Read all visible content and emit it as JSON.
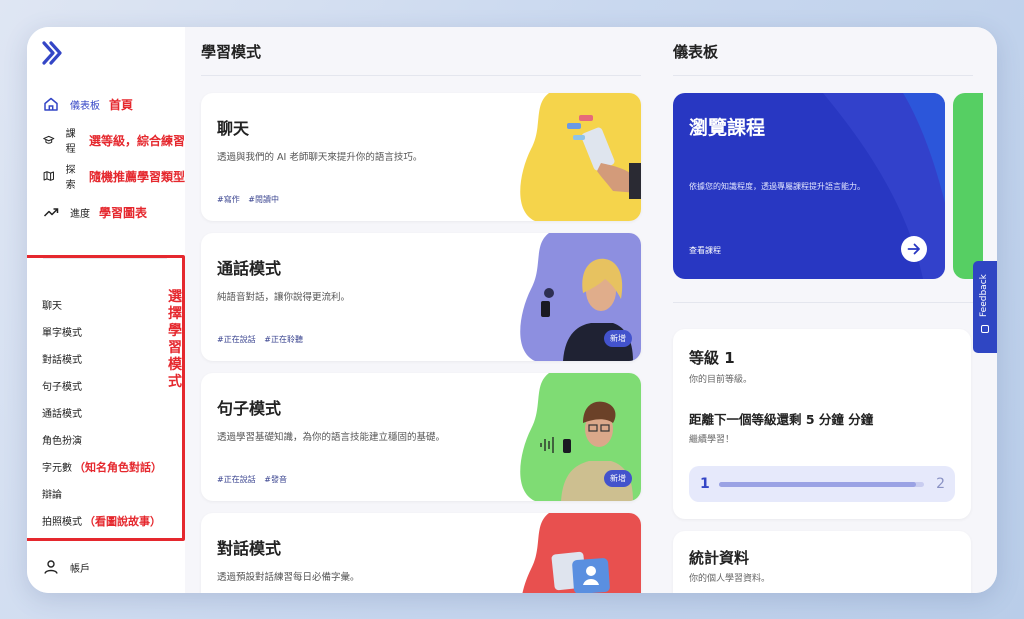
{
  "sidebar": {
    "nav": [
      {
        "label": "儀表板",
        "annotation": "首頁",
        "icon": "home-icon",
        "active": true
      },
      {
        "label": "課程",
        "annotation": "選等級，綜合練習",
        "icon": "graduation-cap-icon"
      },
      {
        "label": "探索",
        "annotation": "隨機推薦學習類型",
        "icon": "map-icon"
      },
      {
        "label": "進度",
        "annotation": "學習圖表",
        "icon": "trending-up-icon"
      }
    ],
    "modes_annotation": "選擇學習模式",
    "modes": [
      {
        "label": "聊天",
        "annotation": ""
      },
      {
        "label": "單字模式",
        "annotation": ""
      },
      {
        "label": "對話模式",
        "annotation": ""
      },
      {
        "label": "句子模式",
        "annotation": ""
      },
      {
        "label": "通話模式",
        "annotation": ""
      },
      {
        "label": "角色扮演",
        "annotation": ""
      },
      {
        "label": "字元數",
        "annotation": "（知名角色對話）"
      },
      {
        "label": "辯論",
        "annotation": ""
      },
      {
        "label": "拍照模式",
        "annotation": "（看圖說故事）"
      }
    ],
    "account_label": "帳戶"
  },
  "main": {
    "title": "學習模式",
    "cards": [
      {
        "title": "聊天",
        "desc": "透過與我們的 AI 老師聊天來提升你的語言技巧。",
        "tags": [
          "#寫作",
          "#閱讀中"
        ],
        "badge": "",
        "color": "#f5d44b"
      },
      {
        "title": "通話模式",
        "desc": "純語音對話，讓你說得更流利。",
        "tags": [
          "#正在說話",
          "#正在聆聽"
        ],
        "badge": "新增",
        "color": "#8d8fe0"
      },
      {
        "title": "句子模式",
        "desc": "透過學習基礎知識，為你的語言技能建立穩固的基礎。",
        "tags": [
          "#正在說話",
          "#發音"
        ],
        "badge": "新增",
        "color": "#7fdc74"
      },
      {
        "title": "對話模式",
        "desc": "透過預設對話練習每日必備字彙。",
        "tags": [],
        "badge": "",
        "color": "#e8504f"
      }
    ]
  },
  "dashboard": {
    "title": "儀表板",
    "browse": {
      "title": "瀏覽課程",
      "desc": "依據您的知識程度，透過專屬課程提升語言能力。",
      "link": "查看課程"
    },
    "feedback_label": "Feedback",
    "level": {
      "title": "等級 1",
      "subtitle": "你的目前等級。",
      "next": "距離下一個等級還剩 5 分鐘 分鐘",
      "continue": "繼續學習！",
      "from": "1",
      "to": "2",
      "progress": 0.96
    },
    "stats": {
      "title": "統計資料",
      "subtitle": "你的個人學習資料。"
    }
  }
}
